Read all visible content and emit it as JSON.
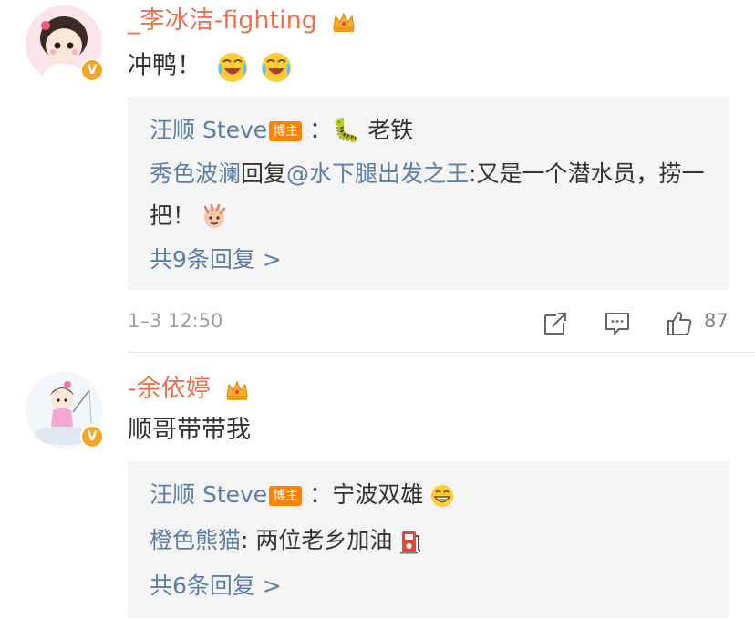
{
  "comments": [
    {
      "username": "_李冰洁-fighting",
      "content": "冲鸭！",
      "replies_box": {
        "line1": {
          "name": "汪顺 Steve",
          "badge": "博主",
          "text": "：🐛 老铁"
        },
        "line2": {
          "name": "秀色波澜",
          "text": "回复",
          "mention": "@水下腿出发之王",
          "text2": ":又是一个潜水员，捞一把！"
        },
        "more_label": "共9条回复 >"
      },
      "time": "1–3 12:50",
      "likes": "87"
    },
    {
      "username": "-余依婷",
      "content": "顺哥带带我",
      "replies_box": {
        "line1": {
          "name": "汪顺 Steve",
          "badge": "博主",
          "text": "：宁波双雄"
        },
        "line2": {
          "name": "橙色熊猫",
          "text": ": 两位老乡加油"
        },
        "more_label": "共6条回复 >"
      }
    }
  ],
  "icons": {
    "verified_badge": "verified-v-icon",
    "crown": "crown-icon",
    "repost": "repost-icon",
    "comment": "comment-icon",
    "like": "thumbs-up-icon"
  },
  "colors": {
    "username": "#eb7350",
    "link": "#5b7ea8",
    "badge": "#ff8200",
    "verified": "#f5a623"
  }
}
